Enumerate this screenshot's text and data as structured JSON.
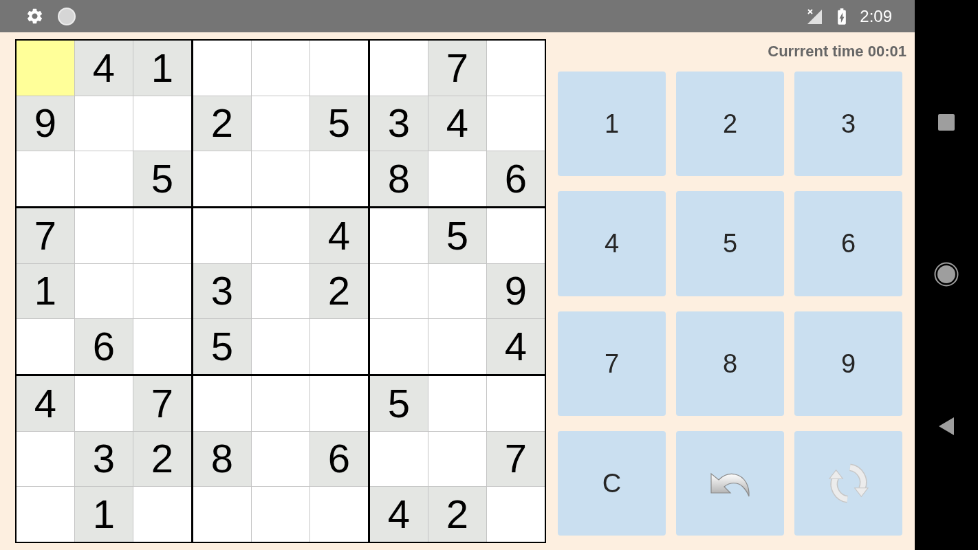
{
  "status_bar": {
    "time": "2:09"
  },
  "board": {
    "rows": [
      [
        {
          "selected": true
        },
        {
          "value": "4",
          "selected": false
        },
        {
          "value": "1",
          "selected": false
        },
        {
          "selected": false
        },
        {
          "selected": false
        },
        {
          "selected": false
        },
        {
          "selected": false
        },
        {
          "value": "7",
          "selected": false
        },
        {
          "selected": false
        }
      ],
      [
        {
          "value": "9",
          "selected": false
        },
        {
          "selected": false
        },
        {
          "selected": false
        },
        {
          "value": "2",
          "selected": false
        },
        {
          "selected": false
        },
        {
          "value": "5",
          "selected": false
        },
        {
          "value": "3",
          "selected": false
        },
        {
          "value": "4",
          "selected": false
        },
        {
          "selected": false
        }
      ],
      [
        {
          "selected": false
        },
        {
          "selected": false
        },
        {
          "value": "5",
          "selected": false
        },
        {
          "selected": false
        },
        {
          "selected": false
        },
        {
          "selected": false
        },
        {
          "value": "8",
          "selected": false
        },
        {
          "selected": false
        },
        {
          "value": "6",
          "selected": false
        }
      ],
      [
        {
          "value": "7",
          "selected": false
        },
        {
          "selected": false
        },
        {
          "selected": false
        },
        {
          "selected": false
        },
        {
          "selected": false
        },
        {
          "value": "4",
          "selected": false
        },
        {
          "selected": false
        },
        {
          "value": "5",
          "selected": false
        },
        {
          "selected": false
        }
      ],
      [
        {
          "value": "1",
          "selected": false
        },
        {
          "selected": false
        },
        {
          "selected": false
        },
        {
          "value": "3",
          "selected": false
        },
        {
          "selected": false
        },
        {
          "value": "2",
          "selected": false
        },
        {
          "selected": false
        },
        {
          "selected": false
        },
        {
          "value": "9",
          "selected": false
        }
      ],
      [
        {
          "selected": false
        },
        {
          "value": "6",
          "selected": false
        },
        {
          "selected": false
        },
        {
          "value": "5",
          "selected": false
        },
        {
          "selected": false
        },
        {
          "selected": false
        },
        {
          "selected": false
        },
        {
          "selected": false
        },
        {
          "value": "4",
          "selected": false
        }
      ],
      [
        {
          "value": "4",
          "selected": false
        },
        {
          "selected": false
        },
        {
          "value": "7",
          "selected": false
        },
        {
          "selected": false
        },
        {
          "selected": false
        },
        {
          "selected": false
        },
        {
          "value": "5",
          "selected": false
        },
        {
          "selected": false
        },
        {
          "selected": false
        }
      ],
      [
        {
          "selected": false
        },
        {
          "value": "3",
          "selected": false
        },
        {
          "value": "2",
          "selected": false
        },
        {
          "value": "8",
          "selected": false
        },
        {
          "selected": false
        },
        {
          "value": "6",
          "selected": false
        },
        {
          "selected": false
        },
        {
          "selected": false
        },
        {
          "value": "7",
          "selected": false
        }
      ],
      [
        {
          "selected": false
        },
        {
          "value": "1",
          "selected": false
        },
        {
          "selected": false
        },
        {
          "selected": false
        },
        {
          "selected": false
        },
        {
          "selected": false
        },
        {
          "value": "4",
          "selected": false
        },
        {
          "value": "2",
          "selected": false
        },
        {
          "selected": false
        }
      ]
    ]
  },
  "timer": {
    "label": "Currrent time 00:01"
  },
  "keypad": [
    {
      "kind": "text",
      "label": "1"
    },
    {
      "kind": "text",
      "label": "2"
    },
    {
      "kind": "text",
      "label": "3"
    },
    {
      "kind": "text",
      "label": "4"
    },
    {
      "kind": "text",
      "label": "5"
    },
    {
      "kind": "text",
      "label": "6"
    },
    {
      "kind": "text",
      "label": "7"
    },
    {
      "kind": "text",
      "label": "8"
    },
    {
      "kind": "text",
      "label": "9"
    },
    {
      "kind": "text",
      "label": "C"
    },
    {
      "kind": "undo"
    },
    {
      "kind": "refresh"
    }
  ]
}
